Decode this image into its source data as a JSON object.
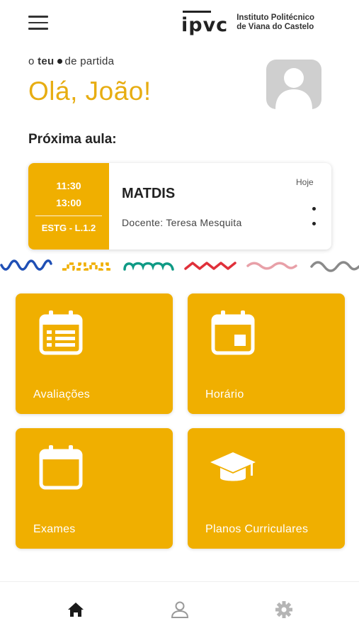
{
  "header": {
    "menu_icon": "hamburger-menu-icon",
    "logo_mark": "ipvc",
    "institution_line1": "Instituto Politécnico",
    "institution_line2": "de Viana do Castelo"
  },
  "welcome": {
    "tagline_prefix": "o",
    "tagline_bold": "teu",
    "tagline_suffix": "de partida",
    "greeting": "Olá, João!"
  },
  "next_class": {
    "section_title": "Próxima aula:",
    "start_time": "11:30",
    "end_time": "13:00",
    "room": "ESTG - L.1.2",
    "course": "MATDIS",
    "teacher": "Docente: Teresa Mesquita",
    "day": "Hoje"
  },
  "tiles": [
    {
      "label": "Avaliações",
      "icon": "calendar-list-icon"
    },
    {
      "label": "Horário",
      "icon": "calendar-event-icon"
    },
    {
      "label": "Exames",
      "icon": "calendar-icon"
    },
    {
      "label": "Planos Curriculares",
      "icon": "graduation-cap-icon"
    }
  ],
  "bottom_nav": [
    {
      "name": "home",
      "icon": "home-icon",
      "active": true
    },
    {
      "name": "profile",
      "icon": "person-icon",
      "active": false
    },
    {
      "name": "settings",
      "icon": "gear-icon",
      "active": false
    }
  ],
  "colors": {
    "accent": "#f0af00",
    "greeting": "#e7ad12",
    "squiggle_blue": "#1f4fb5",
    "squiggle_orange": "#f0af00",
    "squiggle_teal": "#0f9a85",
    "squiggle_red": "#e0303a",
    "squiggle_pink": "#e8a0a8",
    "squiggle_gray": "#8a8a8a"
  }
}
